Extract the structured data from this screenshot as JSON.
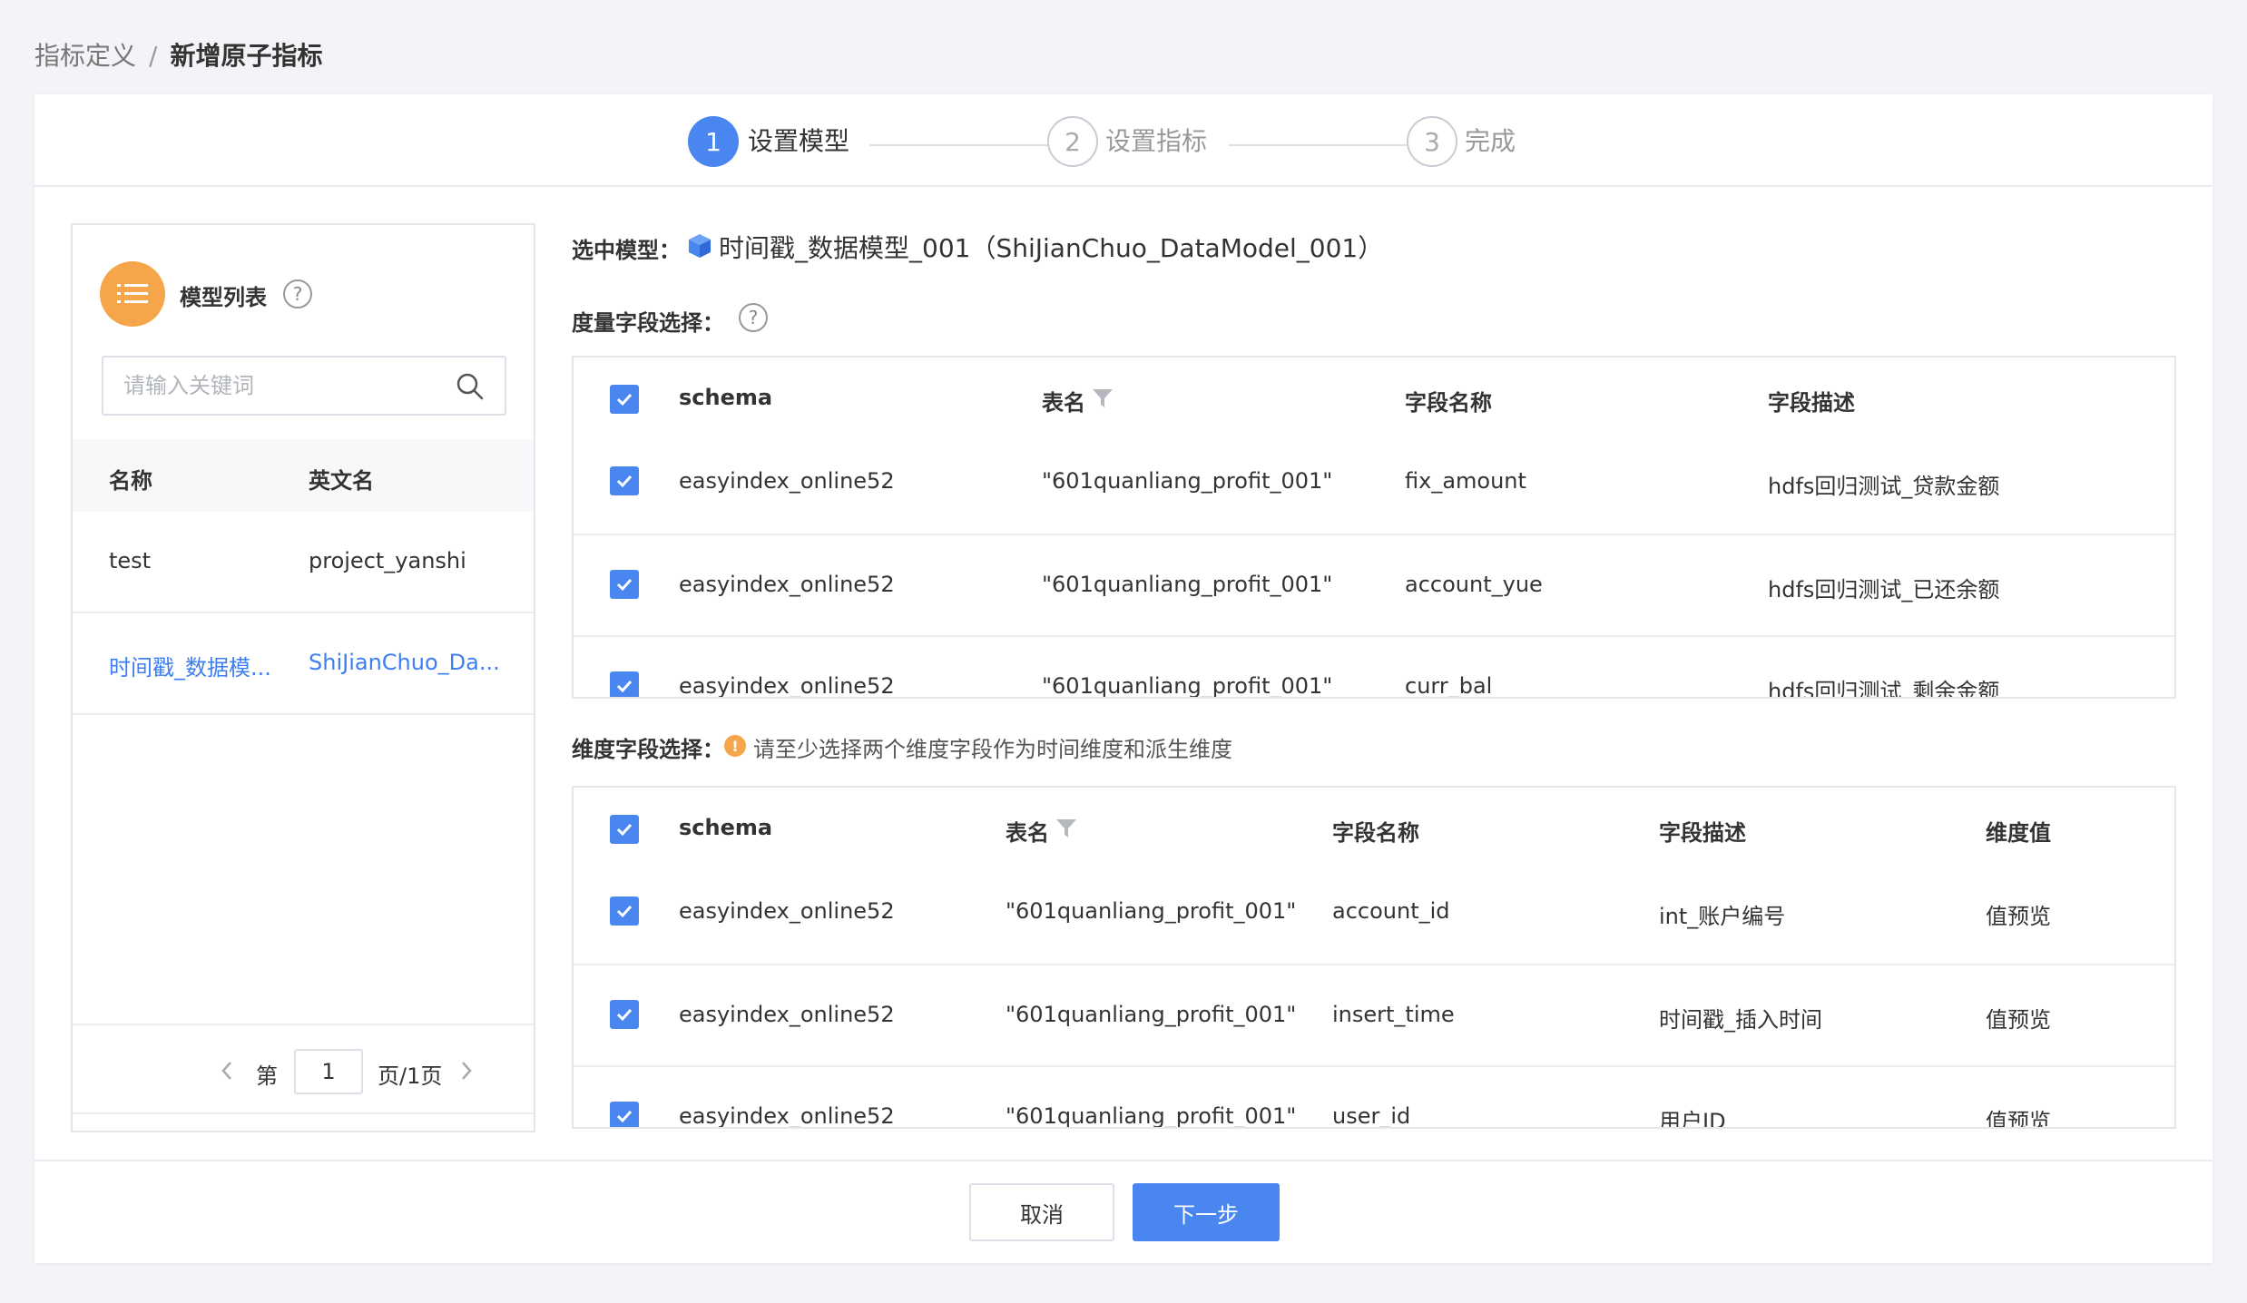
{
  "breadcrumb": {
    "parent": "指标定义",
    "separator": "/",
    "current": "新增原子指标"
  },
  "steps": [
    {
      "num": "1",
      "label": "设置模型"
    },
    {
      "num": "2",
      "label": "设置指标"
    },
    {
      "num": "3",
      "label": "完成"
    }
  ],
  "model_list": {
    "title": "模型列表",
    "help": "?",
    "search_placeholder": "请输入关键词",
    "columns": {
      "name": "名称",
      "en_name": "英文名"
    },
    "rows": [
      {
        "name": "test",
        "en_name": "project_yanshi"
      },
      {
        "name": "时间戳_数据模...",
        "en_name": "ShiJianChuo_Da..."
      }
    ],
    "pager": {
      "prefix": "第",
      "page": "1",
      "suffix": "页/1页"
    }
  },
  "selected_model": {
    "label": "选中模型：",
    "value": "时间戳_数据模型_001（ShiJianChuo_DataModel_001）"
  },
  "measure": {
    "label": "度量字段选择：",
    "help": "?",
    "columns": {
      "schema": "schema",
      "table": "表名",
      "field": "字段名称",
      "desc": "字段描述"
    },
    "rows": [
      {
        "schema": "easyindex_online52",
        "table": "\"601quanliang_profit_001\"",
        "field": "fix_amount",
        "desc": "hdfs回归测试_贷款金额"
      },
      {
        "schema": "easyindex_online52",
        "table": "\"601quanliang_profit_001\"",
        "field": "account_yue",
        "desc": "hdfs回归测试_已还余额"
      },
      {
        "schema": "easyindex_online52",
        "table": "\"601quanliang_profit_001\"",
        "field": "curr_bal",
        "desc": "hdfs回归测试_剩余金额"
      }
    ]
  },
  "dimension": {
    "label": "维度字段选择：",
    "warn_icon": "!",
    "tip": "请至少选择两个维度字段作为时间维度和派生维度",
    "columns": {
      "schema": "schema",
      "table": "表名",
      "field": "字段名称",
      "desc": "字段描述",
      "value": "维度值"
    },
    "rows": [
      {
        "schema": "easyindex_online52",
        "table": "\"601quanliang_profit_001\"",
        "field": "account_id",
        "desc": "int_账户编号",
        "value": "值预览"
      },
      {
        "schema": "easyindex_online52",
        "table": "\"601quanliang_profit_001\"",
        "field": "insert_time",
        "desc": "时间戳_插入时间",
        "value": "值预览"
      },
      {
        "schema": "easyindex_online52",
        "table": "\"601quanliang_profit_001\"",
        "field": "user_id",
        "desc": "用户ID",
        "value": "值预览"
      }
    ]
  },
  "footer": {
    "cancel": "取消",
    "next": "下一步"
  },
  "colors": {
    "primary": "#4a86f0",
    "accent_orange": "#f5a64a",
    "link": "#3d7ff0"
  }
}
